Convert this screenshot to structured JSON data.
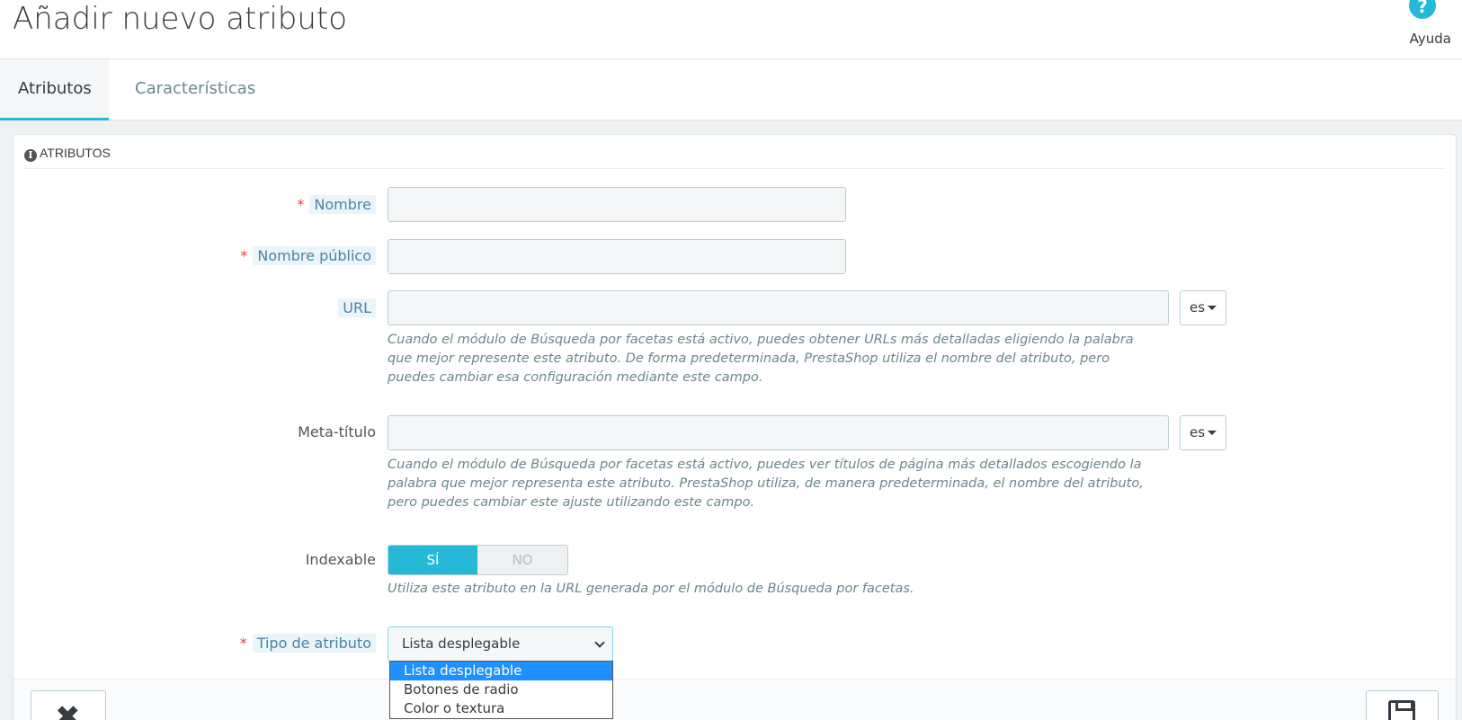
{
  "header": {
    "title": "Añadir nuevo atributo",
    "help_icon": "?",
    "help_label": "Ayuda"
  },
  "tabs": [
    {
      "label": "Atributos",
      "active": true
    },
    {
      "label": "Características",
      "active": false
    }
  ],
  "panel": {
    "heading": "ATRIBUTOS",
    "icon": "info-icon"
  },
  "form": {
    "nombre": {
      "label": "Nombre",
      "required": true,
      "value": ""
    },
    "nombre_publico": {
      "label": "Nombre público",
      "required": true,
      "value": ""
    },
    "url": {
      "label": "URL",
      "value": "",
      "lang": "es",
      "help": "Cuando el módulo de Búsqueda por facetas está activo, puedes obtener URLs más detalladas eligiendo la palabra que mejor represente este atributo. De forma predeterminada, PrestaShop utiliza el nombre del atributo, pero puedes cambiar esa configuración mediante este campo."
    },
    "meta_titulo": {
      "label": "Meta-título",
      "value": "",
      "lang": "es",
      "help": "Cuando el módulo de Búsqueda por facetas está activo, puedes ver títulos de página más detallados escogiendo la palabra que mejor representa este atributo. PrestaShop utiliza, de manera predeterminada, el nombre del atributo, pero puedes cambiar este ajuste utilizando este campo."
    },
    "indexable": {
      "label": "Indexable",
      "yes": "SÍ",
      "no": "NO",
      "value": "yes",
      "help": "Utiliza este atributo en la URL generada por el módulo de Búsqueda por facetas."
    },
    "tipo": {
      "label": "Tipo de atributo",
      "required": true,
      "selected": "Lista desplegable",
      "options": [
        "Lista desplegable",
        "Botones de radio",
        "Color o textura"
      ]
    }
  },
  "colors": {
    "accent": "#25b9d7",
    "required": "#e0403a"
  }
}
